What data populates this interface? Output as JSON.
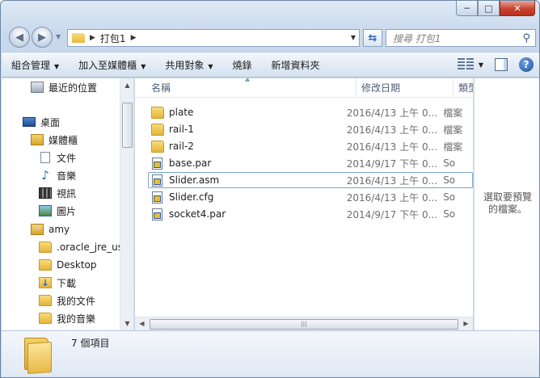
{
  "window": {
    "minimize": "─",
    "maximize": "□",
    "close": "✕"
  },
  "nav": {
    "back": "◀",
    "forward": "▶",
    "address_crumb": "打包1",
    "search_placeholder": "搜尋 打包1"
  },
  "toolbar": {
    "organize": "組合管理",
    "add_to_library": "加入至媒體櫃",
    "share_with": "共用對象",
    "burn": "燒錄",
    "new_folder": "新增資料夾"
  },
  "sidebar": {
    "items": [
      {
        "label": "最近的位置",
        "icon": "recent-places-icon"
      },
      {
        "label": "桌面",
        "icon": "desktop-icon"
      },
      {
        "label": "媒體櫃",
        "icon": "library-icon"
      },
      {
        "label": "文件",
        "icon": "document-icon"
      },
      {
        "label": "音樂",
        "icon": "music-icon"
      },
      {
        "label": "視訊",
        "icon": "video-icon"
      },
      {
        "label": "圖片",
        "icon": "picture-icon"
      },
      {
        "label": "amy",
        "icon": "user-folder-icon"
      },
      {
        "label": ".oracle_jre_usa",
        "icon": "folder-icon"
      },
      {
        "label": "Desktop",
        "icon": "folder-icon"
      },
      {
        "label": "下載",
        "icon": "downloads-icon"
      },
      {
        "label": "我的文件",
        "icon": "folder-icon"
      },
      {
        "label": "我的音樂",
        "icon": "folder-icon"
      }
    ]
  },
  "columns": {
    "name": "名稱",
    "modified": "修改日期",
    "type": "類型"
  },
  "files": [
    {
      "name": "plate",
      "modified": "2016/4/13 上午 0...",
      "type": "檔案",
      "icon": "folder-icon"
    },
    {
      "name": "rail-1",
      "modified": "2016/4/13 上午 0...",
      "type": "檔案",
      "icon": "folder-icon"
    },
    {
      "name": "rail-2",
      "modified": "2016/4/13 上午 0...",
      "type": "檔案",
      "icon": "folder-icon"
    },
    {
      "name": "base.par",
      "modified": "2014/9/17 下午 0...",
      "type": "So",
      "icon": "solid-edge-file-icon"
    },
    {
      "name": "Slider.asm",
      "modified": "2016/4/13 上午 0...",
      "type": "So",
      "icon": "solid-edge-file-icon"
    },
    {
      "name": "Slider.cfg",
      "modified": "2016/4/13 上午 0...",
      "type": "So",
      "icon": "solid-edge-file-icon"
    },
    {
      "name": "socket4.par",
      "modified": "2014/9/17 下午 0...",
      "type": "So",
      "icon": "solid-edge-file-icon"
    }
  ],
  "preview": {
    "message_line1": "選取要預覽",
    "message_line2": "的檔案。"
  },
  "details": {
    "count": "7 個項目"
  }
}
